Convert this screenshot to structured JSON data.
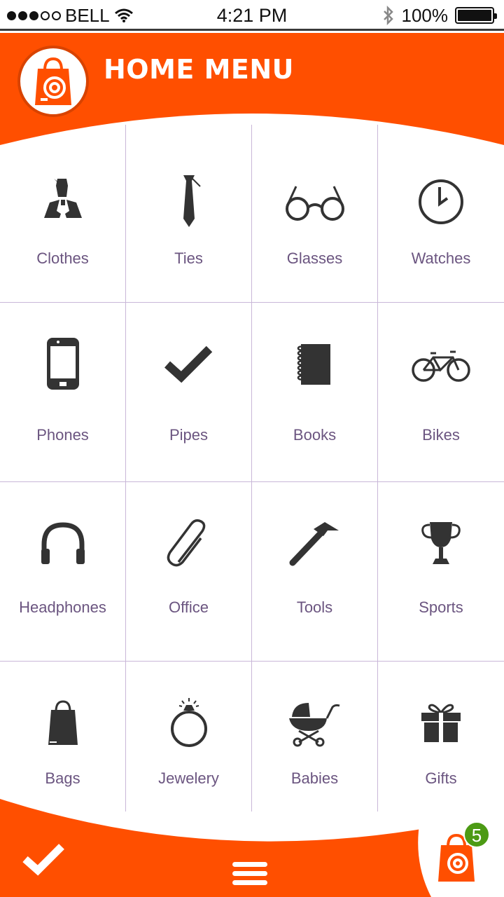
{
  "status_bar": {
    "carrier": "BELL",
    "time": "4:21 PM",
    "battery": "100%",
    "signal_bars_filled": 3,
    "signal_bars_total": 5
  },
  "header": {
    "title": "HOME MENU",
    "accent_color": "#ff4f00"
  },
  "categories": [
    {
      "label": "Clothes",
      "icon": "clothes-icon"
    },
    {
      "label": "Ties",
      "icon": "tie-icon"
    },
    {
      "label": "Glasses",
      "icon": "glasses-icon"
    },
    {
      "label": "Watches",
      "icon": "clock-icon"
    },
    {
      "label": "Phones",
      "icon": "phone-icon"
    },
    {
      "label": "Pipes",
      "icon": "checkmark-icon"
    },
    {
      "label": "Books",
      "icon": "notebook-icon"
    },
    {
      "label": "Bikes",
      "icon": "bicycle-icon"
    },
    {
      "label": "Headphones",
      "icon": "headphones-icon"
    },
    {
      "label": "Office",
      "icon": "paperclip-icon"
    },
    {
      "label": "Tools",
      "icon": "hammer-icon"
    },
    {
      "label": "Sports",
      "icon": "trophy-icon"
    },
    {
      "label": "Bags",
      "icon": "shopping-bag-icon"
    },
    {
      "label": "Jewelery",
      "icon": "ring-icon"
    },
    {
      "label": "Babies",
      "icon": "stroller-icon"
    },
    {
      "label": "Gifts",
      "icon": "gift-icon"
    }
  ],
  "footer": {
    "cart_badge": "5",
    "badge_color": "#4c9a14"
  }
}
